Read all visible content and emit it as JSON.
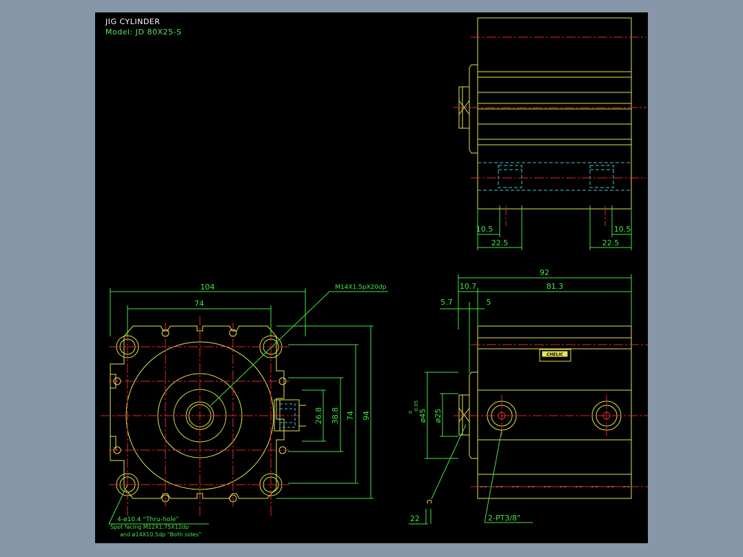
{
  "title_block": {
    "title": "JIG CYLINDER",
    "model": "Model: JD 80X25-S"
  },
  "dimensions": {
    "side_top_10_5_left": "10.5",
    "side_top_10_5_right": "10.5",
    "side_top_22_5_left": "22.5",
    "side_top_22_5_right": "22.5",
    "front_width_104": "104",
    "front_bolt_74_h": "74",
    "front_port_26_8": "26.8",
    "front_port_38_8": "38.8",
    "front_bolt_74_v": "74",
    "front_height_94": "94",
    "side_total_92": "92",
    "side_10_7": "10.7",
    "side_81_3": "81.3",
    "side_5_7": "5.7",
    "side_5": "5",
    "side_25_dia": "ø25",
    "side_45_dia": "ø45",
    "side_45_tol_a": "0",
    "side_45_tol_b": "-0.05",
    "side_22": "22"
  },
  "callouts": {
    "thread": "M14X1.5pX20dp",
    "holes_line1": "4-ø10.4 “Thru-hole”",
    "holes_line2": "Spot facing   M12X1.75X12dp",
    "holes_line3": "and ø14X10.5dp “Both sides”",
    "ports": "2-PT3/8\""
  },
  "label": {
    "brand": "CHELIC"
  },
  "colors": {
    "background": "#000000",
    "frame": "#8796a9",
    "geometry": "#e6e650",
    "centerline": "#e62828",
    "dimension": "#46e646",
    "hidden": "#46c8dc",
    "title": "#ffffff"
  }
}
